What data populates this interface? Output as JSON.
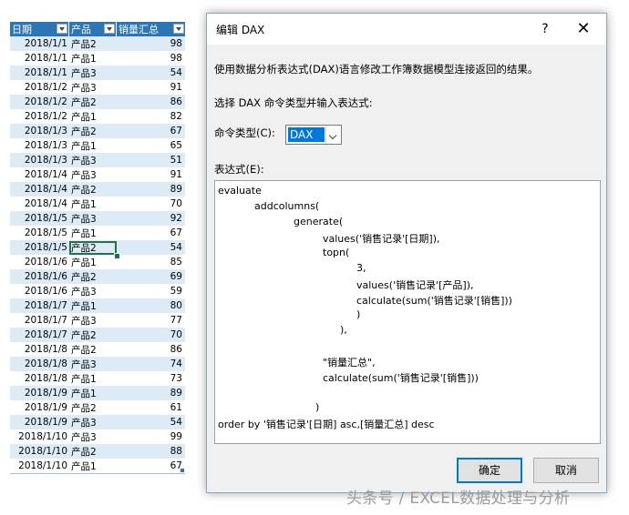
{
  "sheet": {
    "headers": [
      "日期",
      "产品",
      "销量汇总"
    ],
    "rows": [
      [
        "2018/1/1",
        "产品2",
        "98"
      ],
      [
        "2018/1/1",
        "产品1",
        "98"
      ],
      [
        "2018/1/1",
        "产品3",
        "54"
      ],
      [
        "2018/1/2",
        "产品3",
        "91"
      ],
      [
        "2018/1/2",
        "产品2",
        "86"
      ],
      [
        "2018/1/2",
        "产品1",
        "82"
      ],
      [
        "2018/1/3",
        "产品2",
        "67"
      ],
      [
        "2018/1/3",
        "产品1",
        "65"
      ],
      [
        "2018/1/3",
        "产品3",
        "51"
      ],
      [
        "2018/1/4",
        "产品3",
        "91"
      ],
      [
        "2018/1/4",
        "产品2",
        "89"
      ],
      [
        "2018/1/4",
        "产品1",
        "70"
      ],
      [
        "2018/1/5",
        "产品3",
        "92"
      ],
      [
        "2018/1/5",
        "产品1",
        "67"
      ],
      [
        "2018/1/5",
        "产品2",
        "54"
      ],
      [
        "2018/1/6",
        "产品1",
        "85"
      ],
      [
        "2018/1/6",
        "产品2",
        "69"
      ],
      [
        "2018/1/6",
        "产品3",
        "59"
      ],
      [
        "2018/1/7",
        "产品1",
        "80"
      ],
      [
        "2018/1/7",
        "产品3",
        "77"
      ],
      [
        "2018/1/7",
        "产品2",
        "70"
      ],
      [
        "2018/1/8",
        "产品2",
        "86"
      ],
      [
        "2018/1/8",
        "产品3",
        "74"
      ],
      [
        "2018/1/8",
        "产品1",
        "73"
      ],
      [
        "2018/1/9",
        "产品1",
        "89"
      ],
      [
        "2018/1/9",
        "产品2",
        "61"
      ],
      [
        "2018/1/9",
        "产品3",
        "54"
      ],
      [
        "2018/1/10",
        "产品3",
        "99"
      ],
      [
        "2018/1/10",
        "产品2",
        "88"
      ],
      [
        "2018/1/10",
        "产品1",
        "67"
      ]
    ],
    "selected_row": 14
  },
  "dialog": {
    "title": "编辑 DAX",
    "help": "?",
    "close": "✕",
    "description": "使用数据分析表达式(DAX)语言修改工作簿数据模型连接返回的结果。",
    "prompt": "选择 DAX 命令类型并输入表达式:",
    "command_type_label": "命令类型(C):",
    "command_type_value": "DAX",
    "expression_label": "表达式(E):",
    "code_lines": [
      "evaluate",
      "addcolumns(",
      "generate(",
      "values('销售记录'[日期]),",
      "topn(",
      "3,",
      "values('销售记录'[产品]),",
      "calculate(sum('销售记录'[销售]))",
      ")",
      "),",
      "",
      "\"销量汇总\",",
      "calculate(sum('销售记录'[销售]))",
      "",
      ")",
      "order by '销售记录'[日期] asc,[销量汇总] desc"
    ],
    "ok_label": "确定",
    "cancel_label": "取消"
  },
  "watermark": "头条号 / EXCEL数据处理与分析"
}
